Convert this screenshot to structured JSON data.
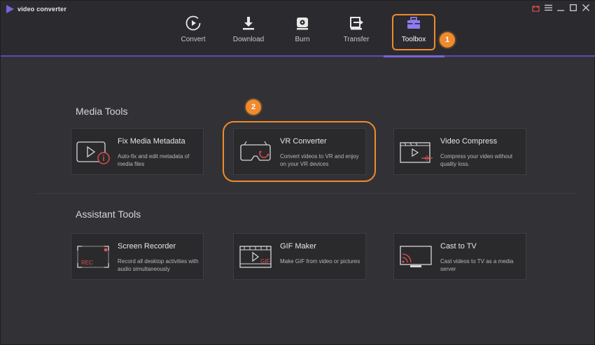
{
  "app": {
    "title": "video converter"
  },
  "window_controls": [
    "gift-icon",
    "menu-icon",
    "minimize-icon",
    "maximize-icon",
    "close-icon"
  ],
  "nav": {
    "items": [
      {
        "label": "Convert",
        "icon": "convert-icon"
      },
      {
        "label": "Download",
        "icon": "download-icon"
      },
      {
        "label": "Burn",
        "icon": "burn-icon"
      },
      {
        "label": "Transfer",
        "icon": "transfer-icon"
      },
      {
        "label": "Toolbox",
        "icon": "toolbox-icon",
        "active": true
      }
    ]
  },
  "callouts": {
    "step1": "1",
    "step2": "2"
  },
  "sections": {
    "media_tools": {
      "title": "Media Tools",
      "cards": [
        {
          "title": "Fix Media Metadata",
          "desc": "Auto-fix and edit metadata of media files",
          "icon": "metadata-icon"
        },
        {
          "title": "VR Converter",
          "desc": "Convert videos to VR and enjoy on your VR devices",
          "icon": "vr-headset-icon"
        },
        {
          "title": "Video Compress",
          "desc": "Compress your video without quality loss.",
          "icon": "compress-icon"
        }
      ]
    },
    "assistant_tools": {
      "title": "Assistant Tools",
      "cards": [
        {
          "title": "Screen Recorder",
          "desc": "Record all desktop activities with audio simultaneously",
          "icon": "screen-recorder-icon",
          "badge": "REC"
        },
        {
          "title": "GIF Maker",
          "desc": "Make GIF from video or pictures",
          "icon": "gif-maker-icon",
          "badge": "GIF"
        },
        {
          "title": "Cast to TV",
          "desc": "Cast videos to TV as a media server",
          "icon": "cast-tv-icon"
        }
      ]
    }
  },
  "colors": {
    "accent": "#7a63d6",
    "highlight": "#f08a2c",
    "background": "#323236"
  }
}
